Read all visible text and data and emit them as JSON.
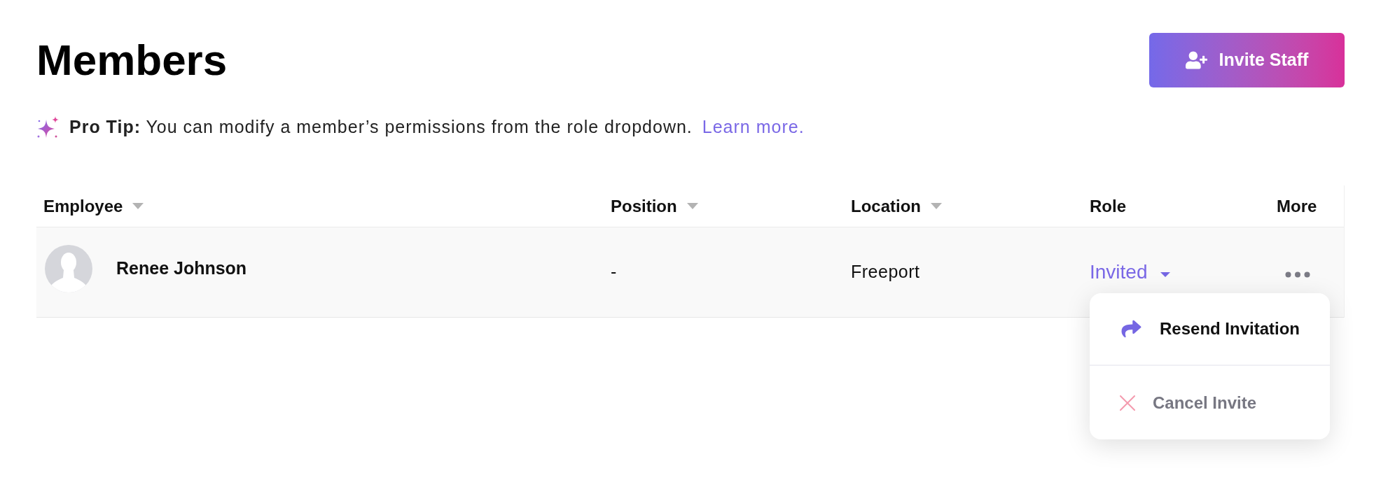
{
  "page": {
    "title": "Members"
  },
  "invite_button": {
    "label": "Invite Staff"
  },
  "tip": {
    "text": "**Pro Tip:** You can modify a member’s permissions from the role dropdown.",
    "link": "Learn more."
  },
  "table": {
    "columns": [
      {
        "label": "Employee",
        "sortable": true
      },
      {
        "label": "Position",
        "sortable": true
      },
      {
        "label": "Location",
        "sortable": true
      },
      {
        "label": "Role",
        "sortable": false
      },
      {
        "label": "More",
        "sortable": false
      }
    ],
    "rows": [
      {
        "employee": "Renee Johnson",
        "position": "-",
        "location": "Freeport",
        "role": "Invited",
        "menu_open": true
      }
    ]
  },
  "more_menu": {
    "items": [
      {
        "kind": "resend",
        "label": "Resend Invitation"
      },
      {
        "kind": "cancel",
        "label": "Cancel Invite"
      }
    ]
  }
}
